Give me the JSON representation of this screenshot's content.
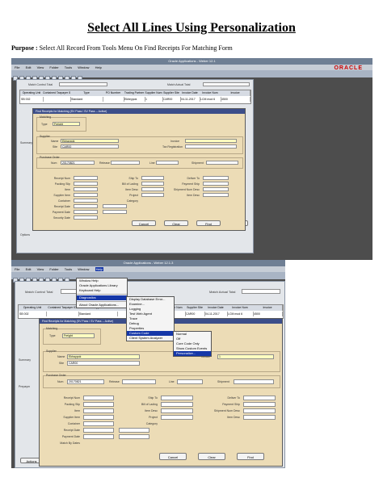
{
  "document": {
    "title": "Select All Lines Using Personalization",
    "purpose_label": "Purpose :",
    "purpose_text": " Select All Record From Tools Menu On Find Receipts For Matching Form"
  },
  "shot1": {
    "window_title": "Oracle Applications - Weber 12.1",
    "menu": [
      "File",
      "Edit",
      "View",
      "Folder",
      "Tools",
      "Window",
      "Help"
    ],
    "logo": "ORACLE",
    "header_label_left": "Match Control Total",
    "header_label_right": "Match Actual Total",
    "table_headers": [
      "Operating Unit",
      "Contained Taxpayer ID",
      "Type",
      "PO Number",
      "Trading Partner",
      "Supplier Num",
      "Supplier Site",
      "Invoice Date",
      "Invoice Num",
      "Invoice"
    ],
    "table_row": [
      "SB 002",
      "",
      "Standard",
      "",
      "Ekheypok",
      "1",
      "CAR00",
      "04-11-2017",
      "LCM mod 6",
      "4500"
    ],
    "dialog_title": "Find Receipts for Matching (SV Pass / SV Pass -- Active)",
    "matching_label": "Matching",
    "type_label": "Type",
    "type_value": "Freight",
    "supplier_group": "Supplier",
    "name_label": "Name",
    "name_value": "Ekhaypok",
    "site_label": "Site",
    "site_value": "CAR00",
    "invoice_label": "Invoice",
    "tax_reg_label": "Tax Registration",
    "po_group": "Purchase Order",
    "po_num_label": "Num",
    "po_num_value": "20170821",
    "release_label": "Release",
    "line_label": "Line",
    "shipment_label": "Shipment",
    "left_fields": [
      "Receipt Num",
      "Packing Slip",
      "Item",
      "Supplier Item",
      "Container",
      "Receipt Date",
      "Payment Date",
      "Security Date"
    ],
    "mid_fields": [
      "Ship To",
      "Bill of Lading",
      "Item Desc",
      "Project",
      "Category"
    ],
    "right_fields": [
      "Deliver To",
      "Payment Ship",
      "Shipment Num Desc",
      "Item Desc"
    ],
    "buttons": [
      "Cancel",
      "Clear",
      "Find"
    ],
    "side_button": "Open",
    "bg_label_summary": "Summary",
    "bg_label_options": "Options"
  },
  "shot2": {
    "window_title": "Oracle Applications - Weber 12.1.3",
    "menu": [
      "File",
      "Edit",
      "View",
      "Folder",
      "Tools",
      "Window",
      "Help"
    ],
    "header_label_left": "Match Control Total",
    "header_label_right": "Match Actual Total",
    "table_headers": [
      "Operating Unit",
      "Contained Taxpayer ID",
      "Type",
      "PO Number",
      "Trading Partner",
      "Supplier Num",
      "Supplier Site",
      "Invoice Date",
      "Invoice Num",
      "Invoice"
    ],
    "table_row": [
      "SB 002",
      "",
      "Standard",
      "",
      "Ekheypok",
      "1",
      "CAR00",
      "04-11-2017",
      "LCM mod 6",
      "4500"
    ],
    "help_menu": {
      "items": [
        "Window Help",
        "Oracle Applications Library",
        "Keyboard Help",
        "Diagnostics",
        "About Oracle Applications..."
      ],
      "highlighted": "Diagnostics"
    },
    "diagnostics_menu": {
      "items": [
        "Display Database Error...",
        "Examine...",
        "Logging",
        "Test Web Agent",
        "Trace",
        "Debug",
        "Properties",
        "Custom Code",
        "Client System Analyzer"
      ],
      "highlighted": "Custom Code"
    },
    "custom_code_menu": {
      "items": [
        "Normal",
        "Off",
        "Core Code Only",
        "Show Custom Events",
        "Personalize..."
      ],
      "highlighted": "Personalize..."
    },
    "dialog_title": "Find Receipts for Matching (SV Pass / SV Pass -- Active)",
    "matching_label": "Matching",
    "type_label": "Type",
    "type_value": "Freight",
    "supplier_group": "Supplier",
    "name_label": "Name",
    "name_value": "Ekhaypok",
    "site_label": "Site",
    "site_value": "CAR00",
    "invoice_label": "Invoice",
    "invoice_value": "1",
    "po_group": "Purchase Order",
    "po_num_label": "Num",
    "po_num_value": "20170821",
    "release_label": "Release",
    "line_label": "Line",
    "shipment_label": "Shipment",
    "left_fields": [
      "Receipt Num",
      "Packing Slip",
      "Item",
      "Supplier Item",
      "Container",
      "Receipt Date",
      "Payment Date",
      "Match By Dates"
    ],
    "mid_fields": [
      "Ship To",
      "Bill of Lading",
      "Item Desc",
      "Project",
      "Category"
    ],
    "right_fields": [
      "Deliver To",
      "Payment Ship",
      "Shipment Num Desc",
      "Item Desc"
    ],
    "buttons": [
      "Cancel",
      "Clear",
      "Find"
    ],
    "bg_label_summary": "Summary",
    "bg_label_prepayment": "Prepaym",
    "bg_label_actions": "Actions"
  },
  "colors": {
    "dialog_bg": "#ecdcb6",
    "title_bar": "#3c4e8a",
    "menu_highlight": "#1537a8",
    "logo_red": "#cc0000",
    "required_field": "#ffffc0"
  }
}
